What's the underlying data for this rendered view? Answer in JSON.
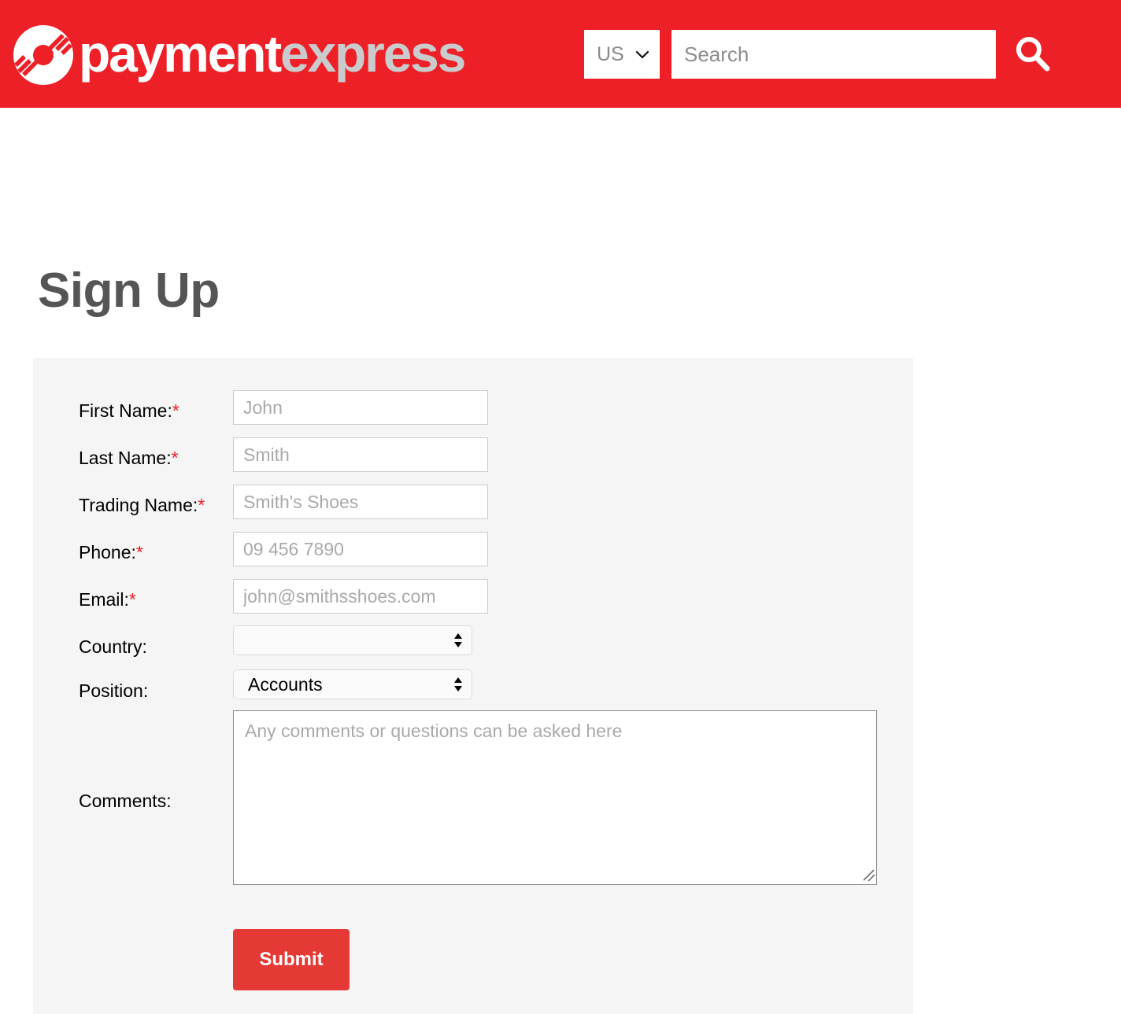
{
  "header": {
    "brand": {
      "icon": "payment-express-logo-icon",
      "word_primary": "payment",
      "word_secondary": "express"
    },
    "country_selector": {
      "value": "US",
      "chevron_icon": "chevron-down-icon"
    },
    "search": {
      "placeholder": "Search",
      "value": "",
      "button_icon": "search-icon"
    },
    "background_color": "#ed2028"
  },
  "page": {
    "title": "Sign Up"
  },
  "form": {
    "fields": [
      {
        "label": "First Name:",
        "required": true,
        "placeholder": "John",
        "value": "",
        "type": "text"
      },
      {
        "label": "Last Name:",
        "required": true,
        "placeholder": "Smith",
        "value": "",
        "type": "text"
      },
      {
        "label": "Trading Name:",
        "required": true,
        "placeholder": "Smith's Shoes",
        "value": "",
        "type": "text"
      },
      {
        "label": "Phone:",
        "required": true,
        "placeholder": "09 456 7890",
        "value": "",
        "type": "text"
      },
      {
        "label": "Email:",
        "required": true,
        "placeholder": "john@smithsshoes.com",
        "value": "",
        "type": "text"
      },
      {
        "label": "Country:",
        "required": false,
        "value": "",
        "type": "select"
      },
      {
        "label": "Position:",
        "required": false,
        "value": "Accounts",
        "type": "select"
      },
      {
        "label": "Comments:",
        "required": false,
        "placeholder": "Any comments or questions can be asked here",
        "value": "",
        "type": "textarea"
      }
    ],
    "required_marker": "*",
    "submit_label": "Submit",
    "submit_color": "#e53935",
    "panel_color": "#f5f5f5"
  }
}
